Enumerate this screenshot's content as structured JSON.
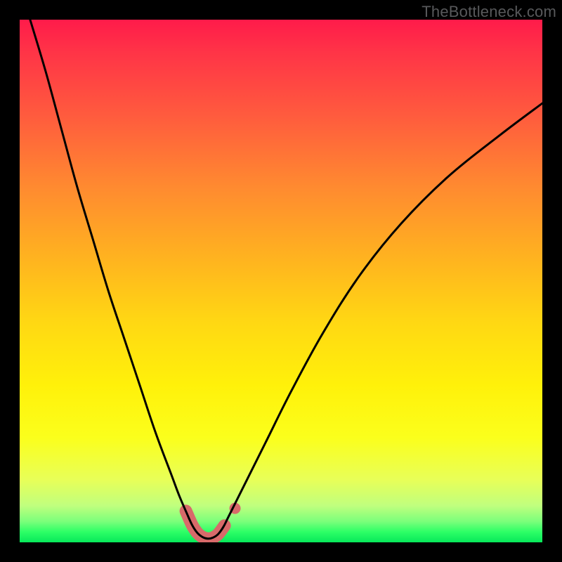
{
  "watermark": "TheBottleneck.com",
  "colors": {
    "frame": "#000000",
    "curve": "#000000",
    "highlight": "#d86a6a",
    "watermark_text": "#58595b"
  },
  "chart_data": {
    "type": "line",
    "title": "",
    "xlabel": "",
    "ylabel": "",
    "xlim": [
      0,
      100
    ],
    "ylim": [
      0,
      100
    ],
    "grid": false,
    "series": [
      {
        "name": "bottleneck-curve",
        "x": [
          2,
          5,
          8,
          11,
          14,
          17,
          20,
          23,
          26,
          29,
          30.5,
          32,
          33,
          34,
          35,
          36,
          37,
          38,
          39,
          40,
          43,
          47,
          52,
          58,
          65,
          73,
          82,
          92,
          100
        ],
        "y": [
          100,
          90,
          79,
          68,
          58,
          48,
          39,
          30,
          21,
          13,
          9,
          5.5,
          3.3,
          1.8,
          1,
          0.7,
          0.9,
          1.6,
          3,
          5,
          11,
          19,
          29,
          40,
          51,
          61,
          70,
          78,
          84
        ]
      }
    ],
    "highlight_segment": {
      "series": "bottleneck-curve",
      "x": [
        31.8,
        33,
        34,
        35,
        36,
        37,
        38,
        39.2
      ],
      "y": [
        6.0,
        3.3,
        1.8,
        1,
        0.7,
        0.9,
        1.6,
        3.2
      ]
    },
    "highlight_dot": {
      "x": 41.2,
      "y": 6.5
    }
  }
}
